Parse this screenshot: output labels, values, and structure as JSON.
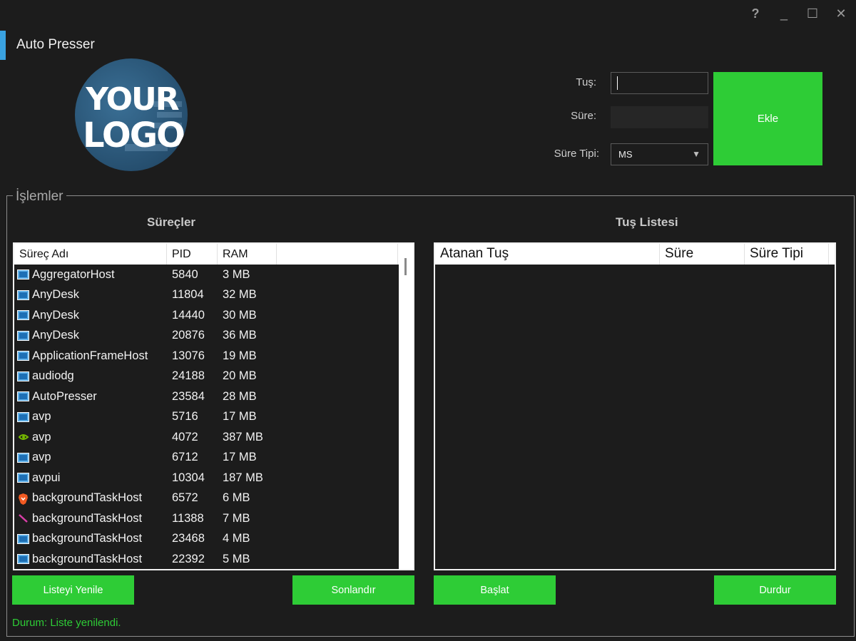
{
  "window": {
    "title": "Auto Presser",
    "controls": {
      "help": "?",
      "minimize": "_",
      "maximize": "☐",
      "close": "✕"
    }
  },
  "logo": {
    "line1": "YOUR",
    "line2": "LOGO"
  },
  "form": {
    "key_label": "Tuş:",
    "key_value": "",
    "duration_label": "Süre:",
    "duration_value": "",
    "duration_type_label": "Süre Tipi:",
    "duration_type_selected": "MS",
    "add_button": "Ekle"
  },
  "operations": {
    "group_title": "İşlemler",
    "processes_title": "Süreçler",
    "keylist_title": "Tuş Listesi",
    "process_columns": [
      "Süreç Adı",
      "PID",
      "RAM"
    ],
    "processes": [
      {
        "name": "AggregatorHost",
        "pid": "5840",
        "ram": "3 MB",
        "icon": "window-icon"
      },
      {
        "name": "AnyDesk",
        "pid": "11804",
        "ram": "32 MB",
        "icon": "window-icon"
      },
      {
        "name": "AnyDesk",
        "pid": "14440",
        "ram": "30 MB",
        "icon": "window-icon"
      },
      {
        "name": "AnyDesk",
        "pid": "20876",
        "ram": "36 MB",
        "icon": "window-icon"
      },
      {
        "name": "ApplicationFrameHost",
        "pid": "13076",
        "ram": "19 MB",
        "icon": "window-icon"
      },
      {
        "name": "audiodg",
        "pid": "24188",
        "ram": "20 MB",
        "icon": "window-icon"
      },
      {
        "name": "AutoPresser",
        "pid": "23584",
        "ram": "28 MB",
        "icon": "window-icon"
      },
      {
        "name": "avp",
        "pid": "5716",
        "ram": "17 MB",
        "icon": "window-icon"
      },
      {
        "name": "avp",
        "pid": "4072",
        "ram": "387 MB",
        "icon": "nvidia-icon"
      },
      {
        "name": "avp",
        "pid": "6712",
        "ram": "17 MB",
        "icon": "window-icon"
      },
      {
        "name": "avpui",
        "pid": "10304",
        "ram": "187 MB",
        "icon": "window-icon"
      },
      {
        "name": "backgroundTaskHost",
        "pid": "6572",
        "ram": "6 MB",
        "icon": "brave-icon"
      },
      {
        "name": "backgroundTaskHost",
        "pid": "11388",
        "ram": "7 MB",
        "icon": "pen-icon"
      },
      {
        "name": "backgroundTaskHost",
        "pid": "23468",
        "ram": "4 MB",
        "icon": "window-icon"
      },
      {
        "name": "backgroundTaskHost",
        "pid": "22392",
        "ram": "5 MB",
        "icon": "window-icon"
      }
    ],
    "key_columns": [
      "Atanan Tuş",
      "Süre",
      "Süre Tipi"
    ],
    "keys": [],
    "buttons": {
      "refresh": "Listeyi Yenile",
      "terminate": "Sonlandır",
      "start": "Başlat",
      "stop": "Durdur"
    }
  },
  "status": "Durum: Liste yenilendi.",
  "colors": {
    "accent": "#3aa2e0",
    "button": "#2ecc36",
    "background": "#1c1c1c"
  }
}
